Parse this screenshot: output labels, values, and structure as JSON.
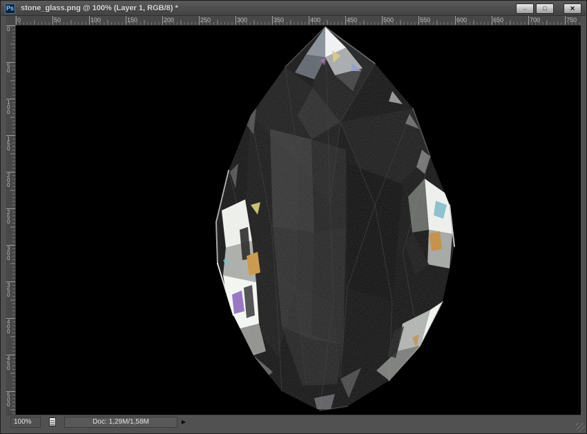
{
  "window": {
    "app_badge": "Ps",
    "title": "stone_glass.png @ 100% (Layer 1, RGB/8) *",
    "controls": {
      "minimize": "_",
      "maximize": "□",
      "close": "×"
    }
  },
  "rulers": {
    "horizontal": [
      "0",
      "50",
      "100",
      "150",
      "200",
      "250",
      "300",
      "350",
      "400",
      "450",
      "500",
      "550",
      "600",
      "650",
      "700",
      "750"
    ],
    "vertical": [
      "0",
      "50",
      "100",
      "150",
      "200",
      "250",
      "300",
      "350",
      "400",
      "450",
      "500"
    ]
  },
  "canvas": {
    "description": "dark faceted glass stone centered on black background"
  },
  "statusbar": {
    "zoom": "100%",
    "doc_label": "Doc: 1,29M/1,58M",
    "menu_arrow": "▶"
  },
  "colors": {
    "frame": "#515151",
    "ruler_bg": "#474747",
    "canvas_bg": "#000000"
  }
}
